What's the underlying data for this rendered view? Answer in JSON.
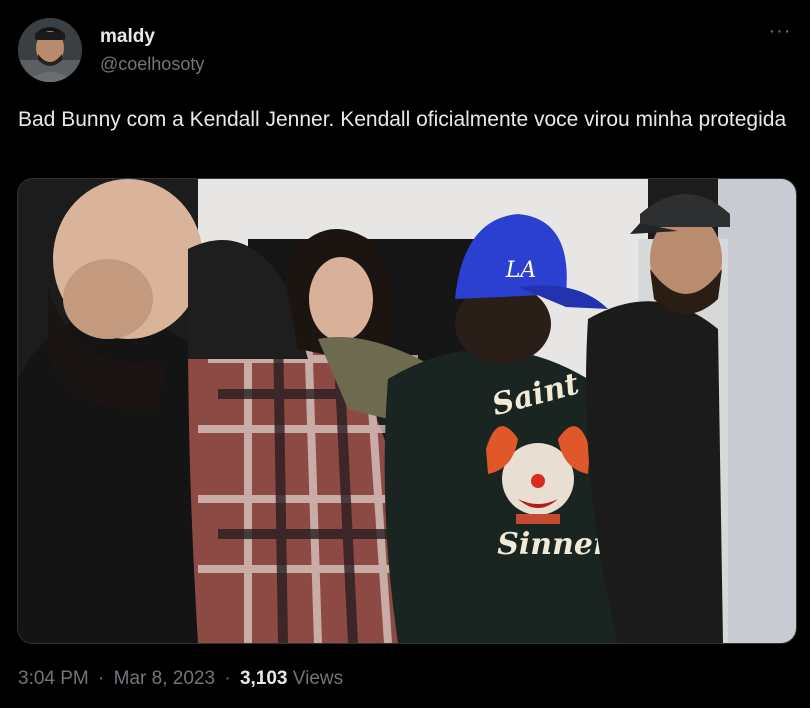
{
  "author": {
    "display_name": "maldy",
    "handle": "@coelhosoty"
  },
  "tweet": {
    "text": "Bad Bunny com a Kendall Jenner. Kendall oficialmente voce virou minha protegida"
  },
  "media": {
    "jacket_text_top": "Saint",
    "jacket_text_bottom": "Sinner",
    "cap_logo": "LA"
  },
  "meta": {
    "time": "3:04 PM",
    "date": "Mar 8, 2023",
    "separator": "·",
    "views_count": "3,103",
    "views_label": "Views"
  },
  "icons": {
    "more": "more-horizontal-icon"
  },
  "colors": {
    "background": "#000000",
    "primary_text": "#e7e9ea",
    "secondary_text": "#71767b",
    "cap_blue": "#2b3fd1"
  }
}
